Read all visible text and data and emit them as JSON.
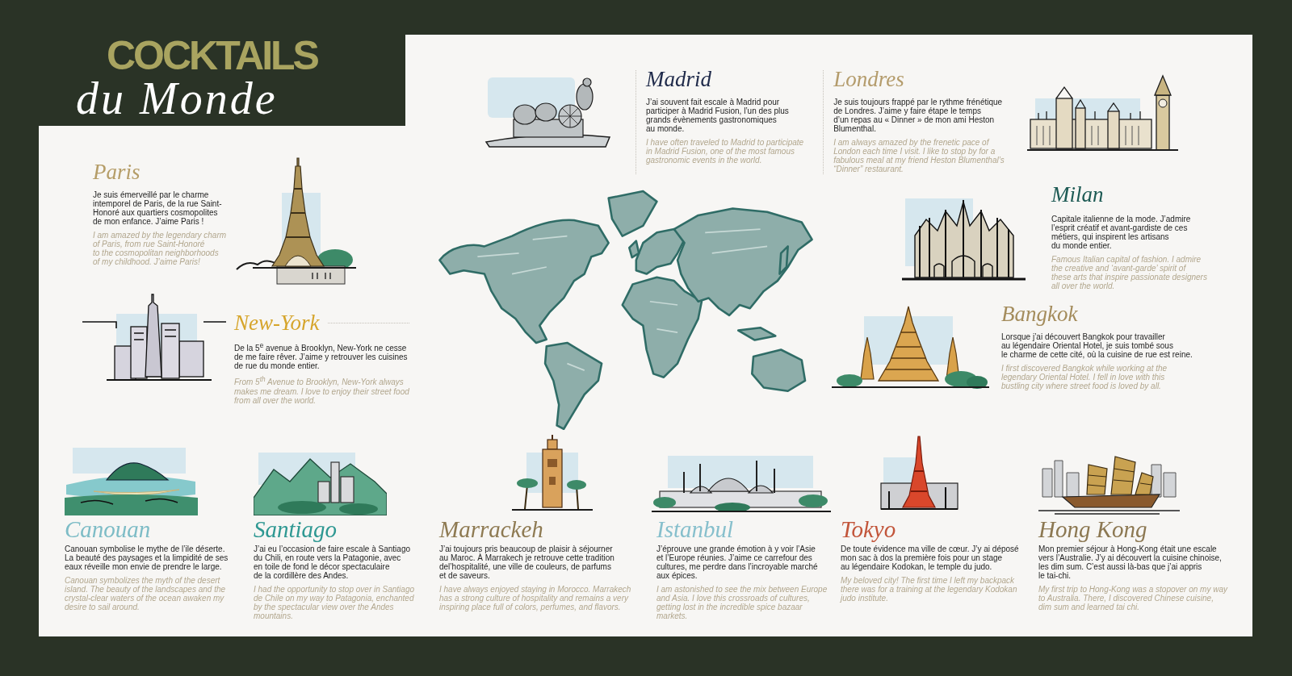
{
  "title": {
    "heading": "COCKTAILS",
    "script": "du Monde"
  },
  "top_row": [
    {
      "name": "Madrid",
      "color": "#1f2a4a",
      "description_fr": "J’ai souvent fait escale à Madrid pour\nparticiper à Madrid Fusion, l’un des plus\ngrands évènements gastronomiques\nau monde.",
      "description_en": "I have often traveled to Madrid to participate\nin Madrid Fusion, one of the most famous\ngastronomic events in the world."
    },
    {
      "name": "Londres",
      "color": "#b49c6c",
      "description_fr": "Je suis toujours frappé par le rythme frénétique\nde Londres. J’aime y faire étape le temps\nd’un repas au « Dinner » de mon ami Heston\nBlumenthal.",
      "description_en": "I am always amazed by the frenetic pace of\nLondon each time I visit. I like to stop by for a\nfabulous meal at my friend Heston Blumenthal’s\n“Dinner” restaurant."
    }
  ],
  "left_column": [
    {
      "name": "Paris",
      "color": "#b59d68",
      "description_fr": "Je suis émerveillé par le charme\nintemporel de Paris, de la rue Saint-\nHonoré aux quartiers cosmopolites\nde mon enfance. J’aime Paris !",
      "description_en": "I am amazed by the legendary charm\nof Paris, from rue Saint-Honoré\nto the cosmopolitan neighborhoods\nof my childhood. J’aime Paris!"
    },
    {
      "name": "New-York",
      "color": "#d6a52c",
      "description_fr": "De la 5$^{e}$ avenue à Brooklyn, New-York ne cesse\nde me faire rêver. J’aime y retrouver les cuisines\nde rue du monde entier.",
      "description_en": "From 5$^{th}$ Avenue to Brooklyn, New-York always\nmakes me dream. I love to enjoy their street food\nfrom all over the world."
    }
  ],
  "right_column": [
    {
      "name": "Milan",
      "color": "#1d5a54",
      "description_fr": "Capitale italienne de la mode. J’admire\nl’esprit créatif et avant-gardiste de ces\nmétiers, qui inspirent les artisans\ndu monde entier.",
      "description_en": "Famous Italian capital of fashion. I admire\nthe creative and ‘avant-garde’ spirit of\nthese arts that inspire passionate designers\nall over the world."
    },
    {
      "name": "Bangkok",
      "color": "#a48c5c",
      "description_fr": "Lorsque j’ai découvert Bangkok pour travailler\nau légendaire Oriental Hotel, je suis tombé sous\nle charme de cette cité, où la cuisine de rue est reine.",
      "description_en": "I first discovered Bangkok while working at the\nlegendary Oriental Hotel. I fell in love with this\nbustling city where street food is loved by all."
    }
  ],
  "bottom_row": [
    {
      "name": "Canouan",
      "color": "#7dbcc6",
      "description_fr": "Canouan symbolise le mythe de l’ile déserte.\nLa beauté des paysages et la limpidité de ses\neaux réveille mon envie de prendre le large.",
      "description_en": "Canouan symbolizes the myth of the desert\nisland. The beauty of the landscapes and the\ncrystal-clear waters of the ocean awaken my\ndesire to sail around."
    },
    {
      "name": "Santiago",
      "color": "#2e9892",
      "description_fr": "J’ai eu l’occasion de faire escale à Santiago\ndu Chili, en route vers la Patagonie, avec\nen toile de fond le décor spectaculaire\nde la cordillère des Andes.",
      "description_en": "I had the opportunity to stop over in Santiago\nde Chile on my way to Patagonia, enchanted\nby the spectacular view over the Andes\nmountains."
    },
    {
      "name": "Marrackeh",
      "color": "#8e7a52",
      "description_fr": "J’ai toujours pris beaucoup de plaisir à séjourner\nau Maroc. À Marrakech je retrouve cette tradition\ndel’hospitalité, une ville de couleurs, de parfums\net de saveurs.",
      "description_en": "I have always enjoyed staying in Morocco. Marrakech\nhas a strong culture of hospitality and remains a very\ninspiring place full of colors, perfumes, and flavors."
    },
    {
      "name": "Istanbul",
      "color": "#86bfcc",
      "description_fr": "J’éprouve une grande émotion à y voir l’Asie\net l’Europe réunies. J’aime ce carrefour des\ncultures, me perdre dans l’incroyable marché\naux épices.",
      "description_en": "I am astonished to see the mix between Europe\nand Asia. I love this crossroads of cultures,\ngetting lost in the incredible spice bazaar\nmarkets."
    },
    {
      "name": "Tokyo",
      "color": "#c2553a",
      "description_fr": "De toute évidence ma ville de cœur. J’y ai déposé\nmon sac à dos la première fois pour un stage\nau légendaire Kodokan, le temple du judo.",
      "description_en": "My beloved city! The first time I left my backpack\nthere was for a training at the legendary Kodokan\njudo institute."
    },
    {
      "name": "Hong Kong",
      "color": "#8c7852",
      "description_fr": "Mon premier séjour à Hong-Kong était une escale\nvers l’Australie. J’y ai découvert la cuisine chinoise,\nles dim sum. C’est aussi là-bas que j’ai appris\nle tai-chi.",
      "description_en": "My first trip to Hong-Kong was a stopover on my way\nto Australia. There, I discovered Chinese cuisine,\ndim sum and learned tai chi."
    }
  ]
}
